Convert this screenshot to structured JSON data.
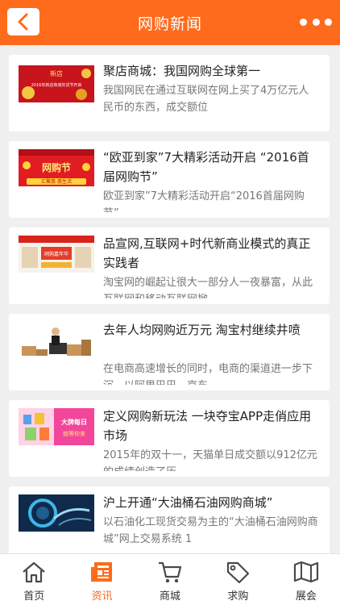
{
  "header": {
    "title": "网购新闻"
  },
  "articles": [
    {
      "title": "聚店商城：我国网购全球第一",
      "desc": "我国网民在通过互联网在网上买了4万亿元人民币的东西，成交额位"
    },
    {
      "title": "“欧亚到家”7大精彩活动开启 “2016首届网购节”",
      "desc": "欧亚到家”7大精彩活动开启“2016首届网购节”"
    },
    {
      "title": "品宣网,互联网+时代新商业模式的真正实践者",
      "desc": "淘宝网的崛起让很大一部分人一夜暴富，从此互联网和移动互联网掀"
    },
    {
      "title": "去年人均网购近万元 淘宝村继续井喷",
      "desc": "在电商高速增长的同时，电商的渠道进一步下沉。以阿里巴巴、京东"
    },
    {
      "title": "定义网购新玩法 一块夺宝APP走俏应用市场",
      "desc": "2015年的双十一，天猫单日成交额以912亿元的成绩创造了历"
    },
    {
      "title": "沪上开通“大油桶石油网购商城”",
      "desc": "以石油化工现货交易为主的“大油桶石油网购商城”网上交易系统 1"
    }
  ],
  "thumb_text": {
    "t1_brand": "新店",
    "t1_caption": "2016年新店商城年货节开启",
    "t2_banner": "网购节",
    "t2_sub": "汇聚惠 惠生活",
    "t3_banner": "网购嘉年华",
    "t5_line1": "大牌每日",
    "t5_line2": "就等你来"
  },
  "tabs": [
    {
      "label": "首页",
      "icon": "home-icon"
    },
    {
      "label": "资讯",
      "icon": "news-icon"
    },
    {
      "label": "商城",
      "icon": "cart-icon"
    },
    {
      "label": "求购",
      "icon": "tag-icon"
    },
    {
      "label": "展会",
      "icon": "map-icon"
    }
  ],
  "colors": {
    "accent": "#fe6b1c",
    "active_tab": "#fe6b1c",
    "icon": "#4a4a4a"
  }
}
